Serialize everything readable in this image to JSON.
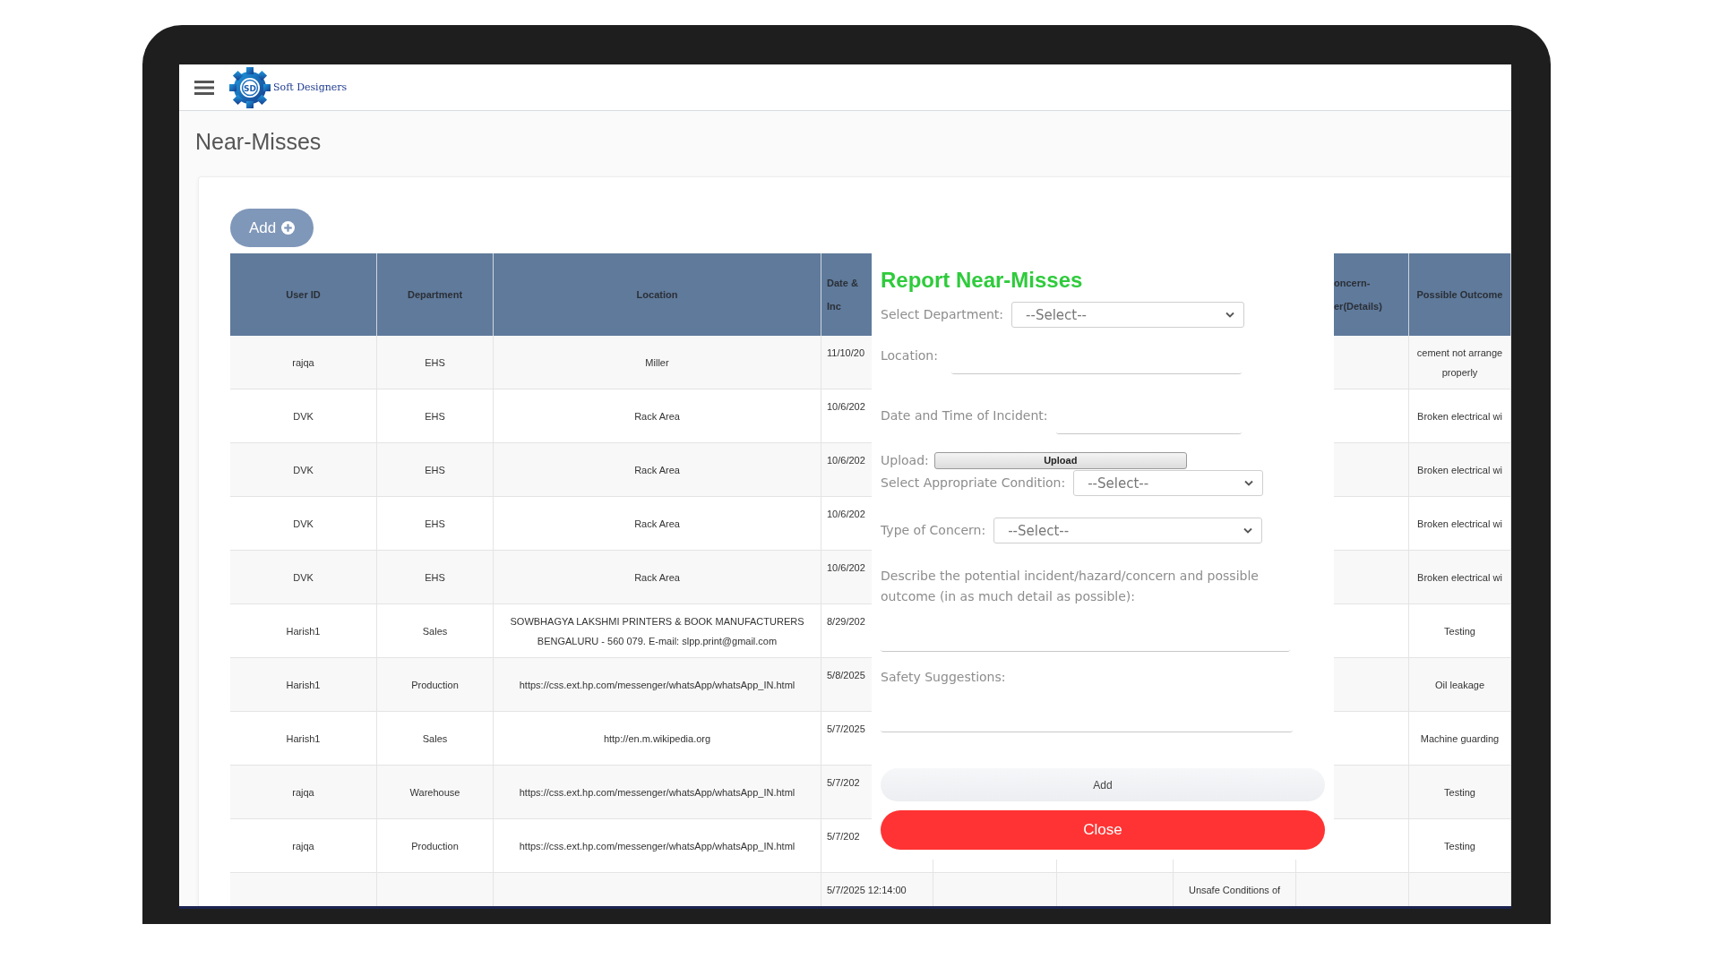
{
  "header": {
    "logo_mark": "SD",
    "brand": "Soft Designers"
  },
  "page_title": "Near-Misses",
  "add_button": "Add",
  "table": {
    "headers": {
      "user_id": [
        "User ID"
      ],
      "department": [
        "Department"
      ],
      "location": [
        "Location"
      ],
      "date_time": [
        "Date &",
        "Inc"
      ],
      "concern_details": [
        "oncern-",
        "er(Details)"
      ],
      "possible_outcome": [
        "Possible Outcome"
      ]
    },
    "rows": [
      {
        "user_id": "rajqa",
        "department": "EHS",
        "location": "Miller",
        "date_time": "11/10/20",
        "possible_outcome": "cement not arrange properly"
      },
      {
        "user_id": "DVK",
        "department": "EHS",
        "location": "Rack Area",
        "date_time": "10/6/202",
        "possible_outcome": "Broken electrical wi"
      },
      {
        "user_id": "DVK",
        "department": "EHS",
        "location": "Rack Area",
        "date_time": "10/6/202",
        "possible_outcome": "Broken electrical wi"
      },
      {
        "user_id": "DVK",
        "department": "EHS",
        "location": "Rack Area",
        "date_time": "10/6/202",
        "possible_outcome": "Broken electrical wi"
      },
      {
        "user_id": "DVK",
        "department": "EHS",
        "location": "Rack Area",
        "date_time": "10/6/202",
        "possible_outcome": "Broken electrical wi"
      },
      {
        "user_id": "Harish1",
        "department": "Sales",
        "location": "SOWBHAGYA LAKSHMI PRINTERS & BOOK MANUFACTURERS BENGALURU - 560 079. E-mail: slpp.print@gmail.com",
        "date_time": "8/29/202",
        "possible_outcome": "Testing"
      },
      {
        "user_id": "Harish1",
        "department": "Production",
        "location": "https://css.ext.hp.com/messenger/whatsApp/whatsApp_IN.html",
        "date_time": "5/8/2025",
        "possible_outcome": "Oil leakage"
      },
      {
        "user_id": "Harish1",
        "department": "Sales",
        "location": "http://en.m.wikipedia.org",
        "date_time": "5/7/2025",
        "possible_outcome": "Machine guarding"
      },
      {
        "user_id": "rajqa",
        "department": "Warehouse",
        "location": "https://css.ext.hp.com/messenger/whatsApp/whatsApp_IN.html",
        "date_time": "5/7/202",
        "possible_outcome": "Testing"
      },
      {
        "user_id": "rajqa",
        "department": "Production",
        "location": "https://css.ext.hp.com/messenger/whatsApp/whatsApp_IN.html",
        "date_time": "5/7/202",
        "possible_outcome": "Testing"
      },
      {
        "date_time": "5/7/2025 12:14:00",
        "column_7": "Unsafe Conditions of"
      }
    ]
  },
  "modal": {
    "title": "Report Near-Misses",
    "fields": [
      {
        "kind": "select",
        "label": "Select Department:",
        "value": "--Select--"
      },
      {
        "kind": "text",
        "label": "Location:"
      },
      {
        "kind": "text",
        "label": "Date and Time of Incident:"
      },
      {
        "kind": "upload",
        "label": "Upload:",
        "button": "Upload"
      },
      {
        "kind": "select",
        "label": "Select Appropriate Condition:",
        "value": "--Select--"
      },
      {
        "kind": "select",
        "label": "Type of Concern:",
        "value": "--Select--"
      },
      {
        "kind": "textarea",
        "label": "Describe the potential incident/hazard/concern and possible outcome (in as much detail as possible):"
      },
      {
        "kind": "textarea",
        "label": "Safety Suggestions:"
      }
    ],
    "add_button": "Add",
    "close_button": "Close"
  }
}
